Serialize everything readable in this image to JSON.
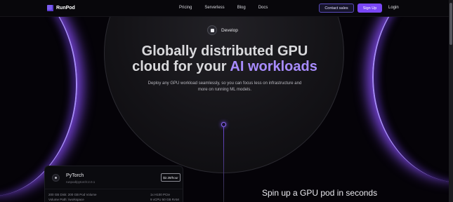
{
  "nav": {
    "brand": "RunPod",
    "links": [
      "Pricing",
      "Serverless",
      "Blog",
      "Docs"
    ],
    "contact_sales": "Contact sales",
    "sign_up": "Sign Up",
    "login": "Login"
  },
  "hero": {
    "badge": "Develop",
    "title_line1": "Globally distributed GPU",
    "title_line2_plain": "cloud for your ",
    "title_line2_accent": "AI workloads",
    "subtitle": "Deploy any GPU workload seamlessly, so you can focus less on infrastructure and more on running ML models."
  },
  "pod_card": {
    "name": "PyTorch",
    "image": "runpod/pytorch:2.0.1",
    "deploy_label": "$2.39/hour",
    "spec1_line1": "200 GB Disk: 200 GB Pod Volume",
    "spec1_line2": "Volume Path: /workspace",
    "spec2_line1": "1x H100 PCIe",
    "spec2_line2": "9 vCPU 50 GB RAM"
  },
  "section": {
    "heading": "Spin up a GPU pod in seconds"
  },
  "colors": {
    "accent": "#a88cff",
    "brand": "#7a47f5"
  }
}
